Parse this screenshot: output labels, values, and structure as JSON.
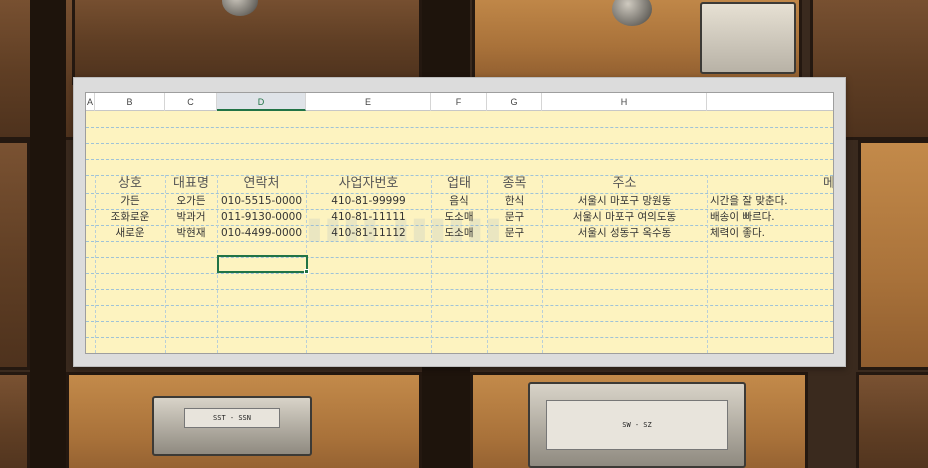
{
  "background": {
    "drawer_labels": [
      "SST - SSN",
      "SW - SZ"
    ]
  },
  "sheet": {
    "columns": [
      {
        "letter": "A"
      },
      {
        "letter": "B"
      },
      {
        "letter": "C"
      },
      {
        "letter": "D"
      },
      {
        "letter": "E"
      },
      {
        "letter": "F"
      },
      {
        "letter": "G"
      },
      {
        "letter": "H"
      },
      {
        "letter": ""
      }
    ],
    "active_column": "D",
    "headers": [
      "상호",
      "대표명",
      "연락처",
      "사업자번호",
      "업태",
      "종목",
      "주소",
      "메"
    ],
    "rows": [
      [
        "가든",
        "오가든",
        "010-5515-0000",
        "410-81-99999",
        "음식",
        "한식",
        "서울시 마포구 망원동",
        "시간을 잘 맞춘다."
      ],
      [
        "조화로운",
        "박과거",
        "011-9130-0000",
        "410-81-11111",
        "도소매",
        "문구",
        "서울시 마포구 여의도동",
        "배송이 빠르다."
      ],
      [
        "새로운",
        "박현재",
        "010-4499-0000",
        "410-81-11112",
        "도소매",
        "문구",
        "서울시 성동구 옥수동",
        "체력이 좋다."
      ]
    ]
  },
  "colors": {
    "sheet_bg": "#fdf3c0",
    "accent_green": "#217346",
    "grid_line": "#9fc3d7"
  }
}
